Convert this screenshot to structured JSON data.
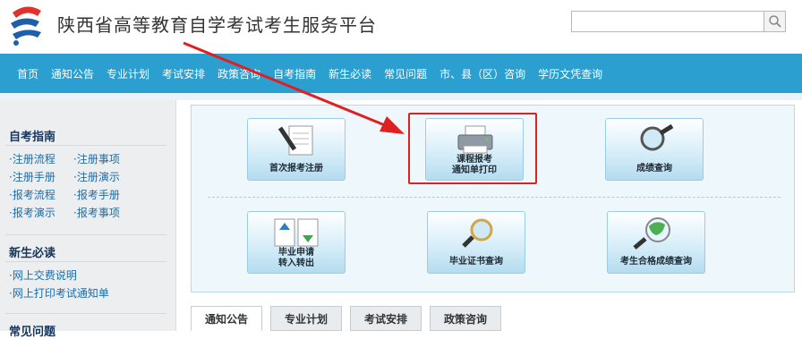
{
  "header": {
    "title": "陕西省高等教育自学考试考生服务平台",
    "search_placeholder": ""
  },
  "nav": {
    "items": [
      "首页",
      "通知公告",
      "专业计划",
      "考试安排",
      "政策咨询",
      "自考指南",
      "新生必读",
      "常见问题",
      "市、县（区）咨询",
      "学历文凭查询"
    ]
  },
  "sidebar": {
    "section1": {
      "title": "自考指南",
      "links": [
        "·注册流程",
        "·注册事项",
        "·注册手册",
        "·注册演示",
        "·报考流程",
        "·报考手册",
        "·报考演示",
        "·报考事项"
      ]
    },
    "section2": {
      "title": "新生必读",
      "links": [
        "·网上交费说明",
        "·网上打印考试通知单"
      ]
    },
    "section3": {
      "title": "常见问题"
    }
  },
  "tiles": {
    "first_register": "首次报考注册",
    "course_line1": "课程报考",
    "course_line2": "通知单打印",
    "score_query": "成绩查询",
    "grad_line1": "毕业申请",
    "grad_line2": "转入转出",
    "cert_query": "毕业证书查询",
    "pass_query": "考生合格成绩查询"
  },
  "tabs": [
    "通知公告",
    "专业计划",
    "考试安排",
    "政策咨询"
  ],
  "colors": {
    "nav_bg": "#2b9fcf",
    "highlight": "#e02020",
    "arrow": "#e02020"
  }
}
